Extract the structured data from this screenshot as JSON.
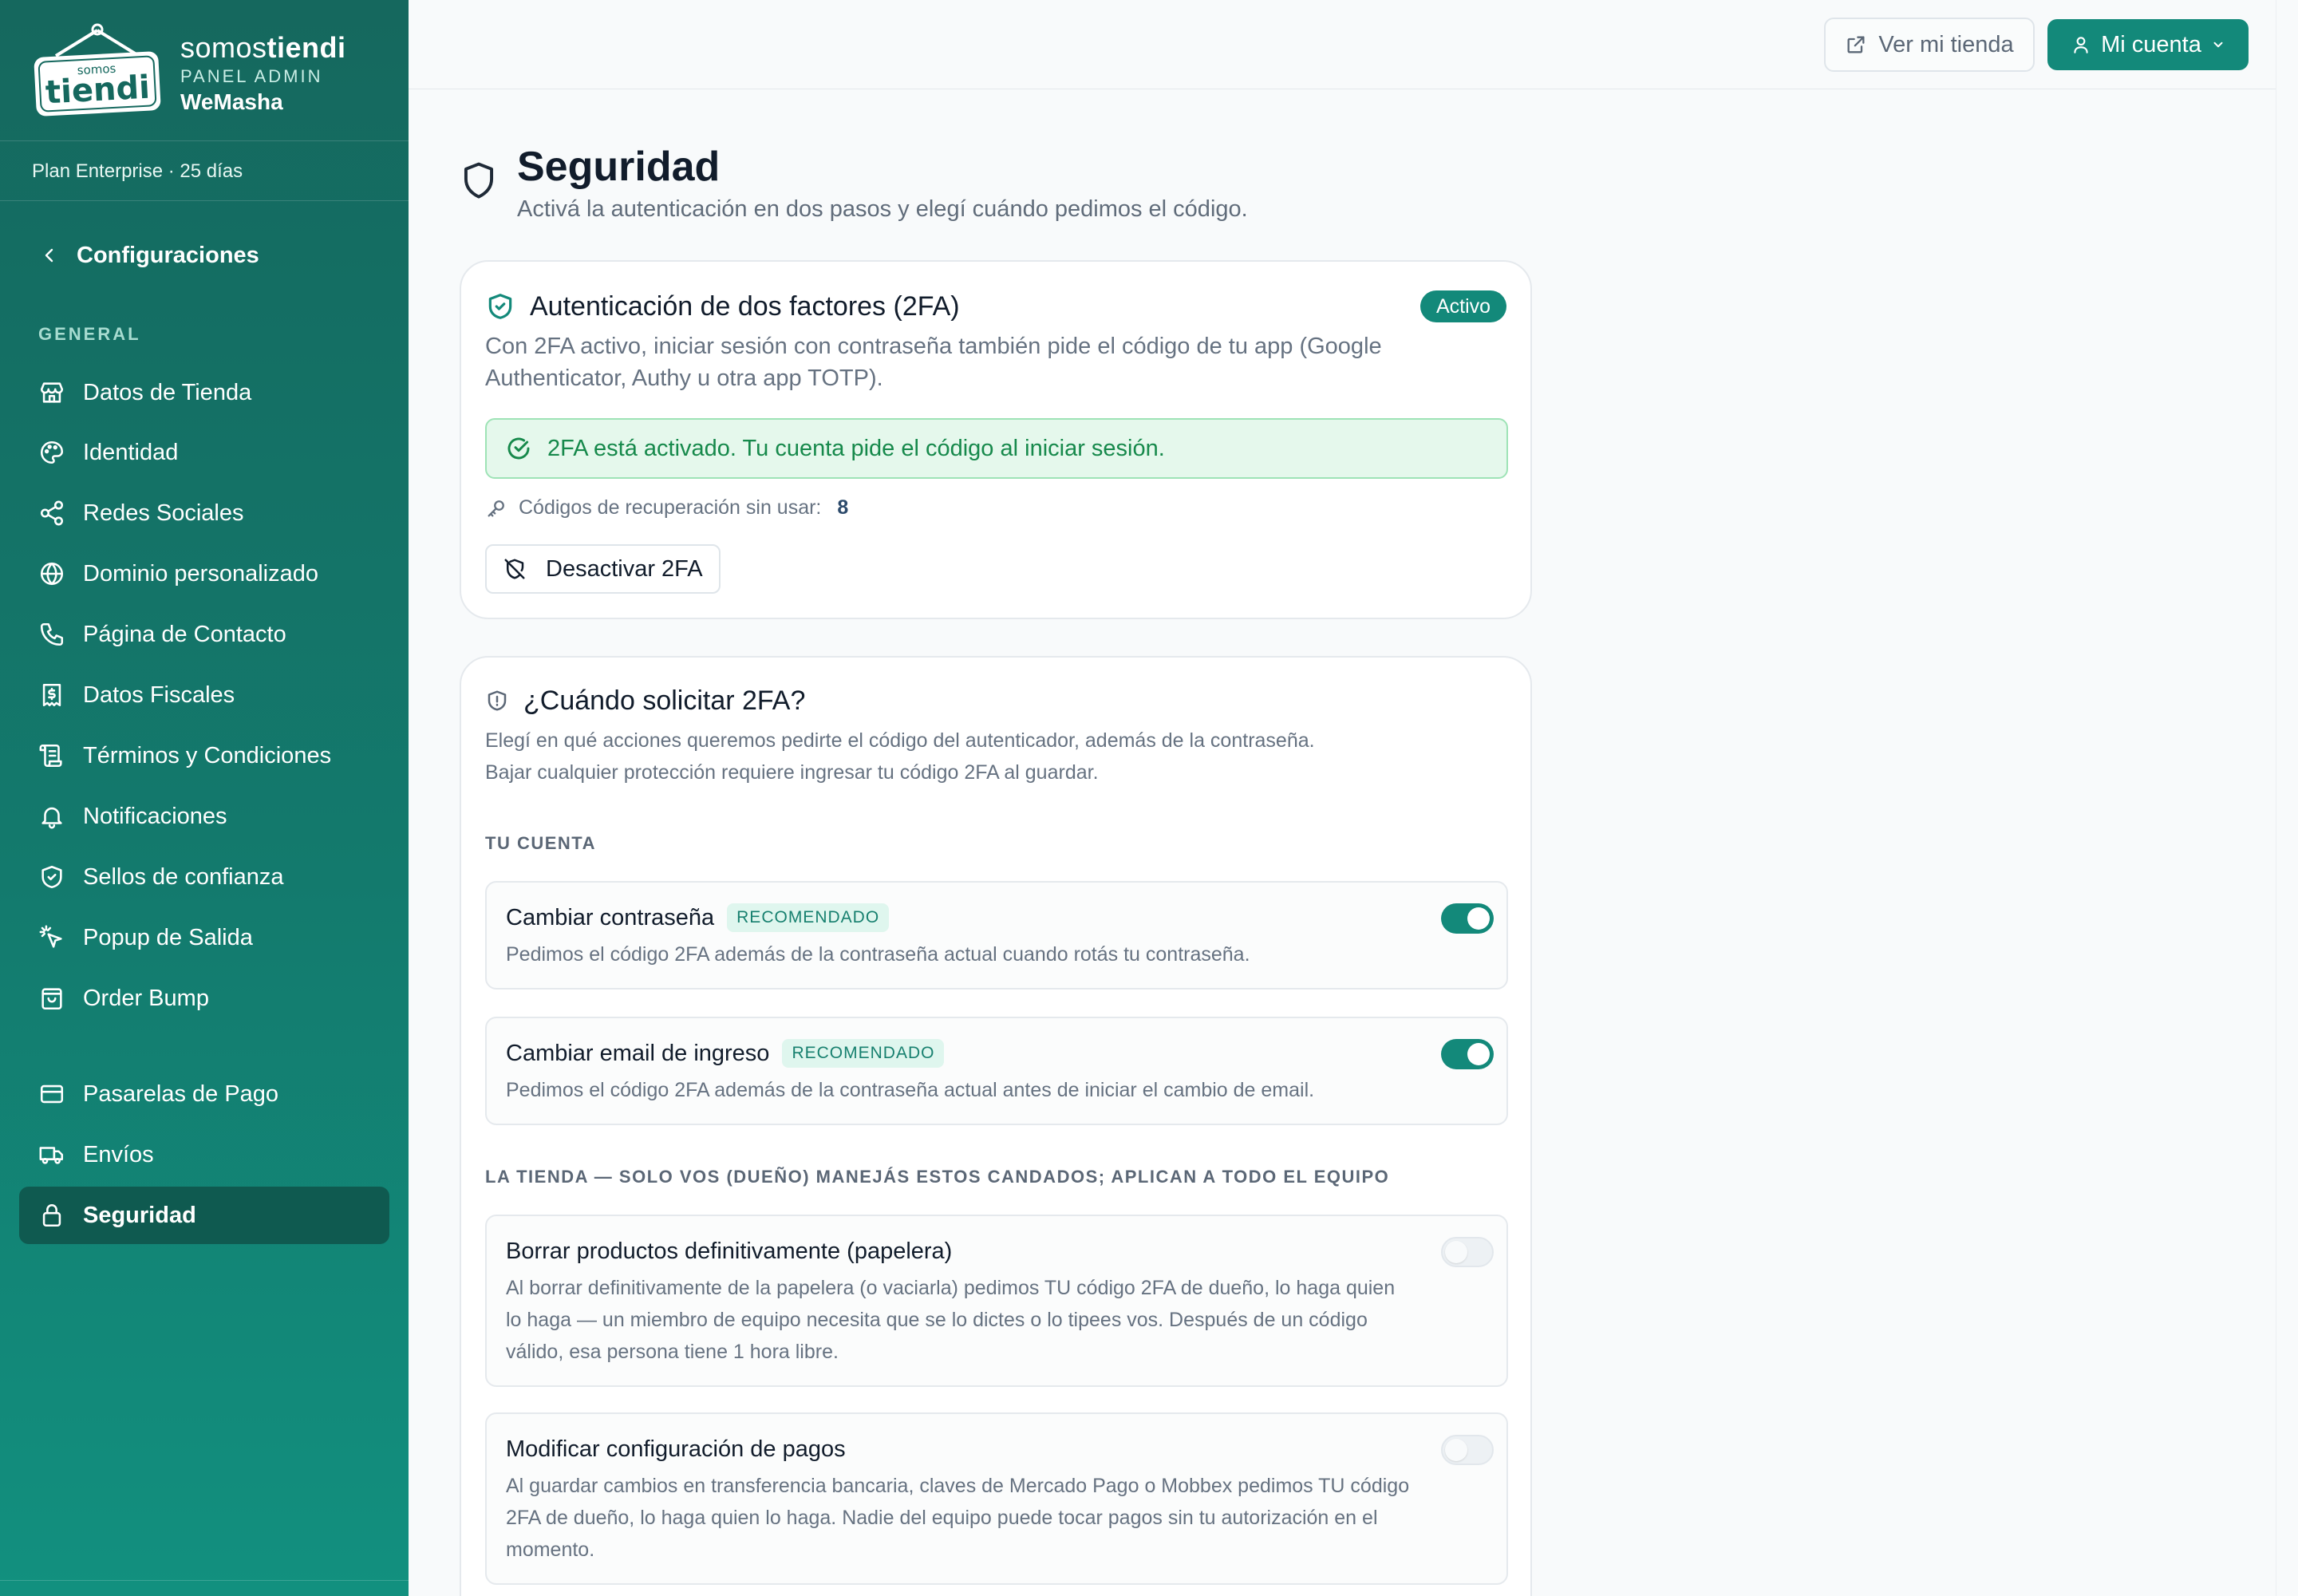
{
  "sidebar": {
    "brand": {
      "logo_small": "somos",
      "logo_big": "tiendi",
      "name_light": "somos",
      "name_bold": "tiendi",
      "panel": "PANEL ADMIN",
      "store": "WeMasha"
    },
    "plan": "Plan Enterprise · 25 días",
    "back_label": "Configuraciones",
    "group_general": "GENERAL",
    "items": [
      {
        "label": "Datos de Tienda",
        "icon": "store-icon"
      },
      {
        "label": "Identidad",
        "icon": "palette-icon"
      },
      {
        "label": "Redes Sociales",
        "icon": "share-icon"
      },
      {
        "label": "Dominio personalizado",
        "icon": "globe-icon"
      },
      {
        "label": "Página de Contacto",
        "icon": "phone-icon"
      },
      {
        "label": "Datos Fiscales",
        "icon": "receipt-icon"
      },
      {
        "label": "Términos y Condiciones",
        "icon": "scroll-icon"
      },
      {
        "label": "Notificaciones",
        "icon": "bell-icon"
      },
      {
        "label": "Sellos de confianza",
        "icon": "shield-check-icon"
      },
      {
        "label": "Popup de Salida",
        "icon": "pointer-click-icon"
      },
      {
        "label": "Order Bump",
        "icon": "shopping-bag-icon"
      },
      {
        "label": "Pasarelas de Pago",
        "icon": "credit-card-icon"
      },
      {
        "label": "Envíos",
        "icon": "truck-icon"
      },
      {
        "label": "Seguridad",
        "icon": "lock-icon",
        "active": true
      }
    ]
  },
  "topbar": {
    "view_store": "Ver mi tienda",
    "account": "Mi cuenta"
  },
  "page": {
    "title": "Seguridad",
    "subtitle": "Activá la autenticación en dos pasos y elegí cuándo pedimos el código."
  },
  "twofa_card": {
    "title": "Autenticación de dos factores (2FA)",
    "badge": "Activo",
    "description": "Con 2FA activo, iniciar sesión con contraseña también pide el código de tu app (Google Authenticator, Authy u otra app TOTP).",
    "notice": "2FA está activado. Tu cuenta pide el código al iniciar sesión.",
    "recovery_label": "Códigos de recuperación sin usar:",
    "recovery_count": "8",
    "disable_button": "Desactivar 2FA"
  },
  "when_card": {
    "title": "¿Cuándo solicitar 2FA?",
    "description_line1": "Elegí en qué acciones queremos pedirte el código del autenticador, además de la contraseña.",
    "description_line2": "Bajar cualquier protección requiere ingresar tu código 2FA al guardar.",
    "section_account": "TU CUENTA",
    "section_store": "LA TIENDA — SOLO VOS (DUEÑO) MANEJÁS ESTOS CANDADOS; APLICAN A TODO EL EQUIPO",
    "recommended_label": "RECOMENDADO",
    "options": [
      {
        "title": "Cambiar contraseña",
        "recommended": true,
        "enabled": true,
        "description": "Pedimos el código 2FA además de la contraseña actual cuando rotás tu contraseña."
      },
      {
        "title": "Cambiar email de ingreso",
        "recommended": true,
        "enabled": true,
        "description": "Pedimos el código 2FA además de la contraseña actual antes de iniciar el cambio de email."
      },
      {
        "title": "Borrar productos definitivamente (papelera)",
        "recommended": false,
        "enabled": false,
        "description": "Al borrar definitivamente de la papelera (o vaciarla) pedimos TU código 2FA de dueño, lo haga quien lo haga — un miembro de equipo necesita que se lo dictes o lo tipees vos. Después de un código válido, esa persona tiene 1 hora libre."
      },
      {
        "title": "Modificar configuración de pagos",
        "recommended": false,
        "enabled": false,
        "description": "Al guardar cambios en transferencia bancaria, claves de Mercado Pago o Mobbex pedimos TU código 2FA de dueño, lo haga quien lo haga. Nadie del equipo puede tocar pagos sin tu autorización en el momento."
      }
    ]
  },
  "colors": {
    "brand": "#13897a",
    "sidebar_top": "#15685e",
    "success_bg": "#e5f8ec",
    "success_text": "#16894b"
  }
}
